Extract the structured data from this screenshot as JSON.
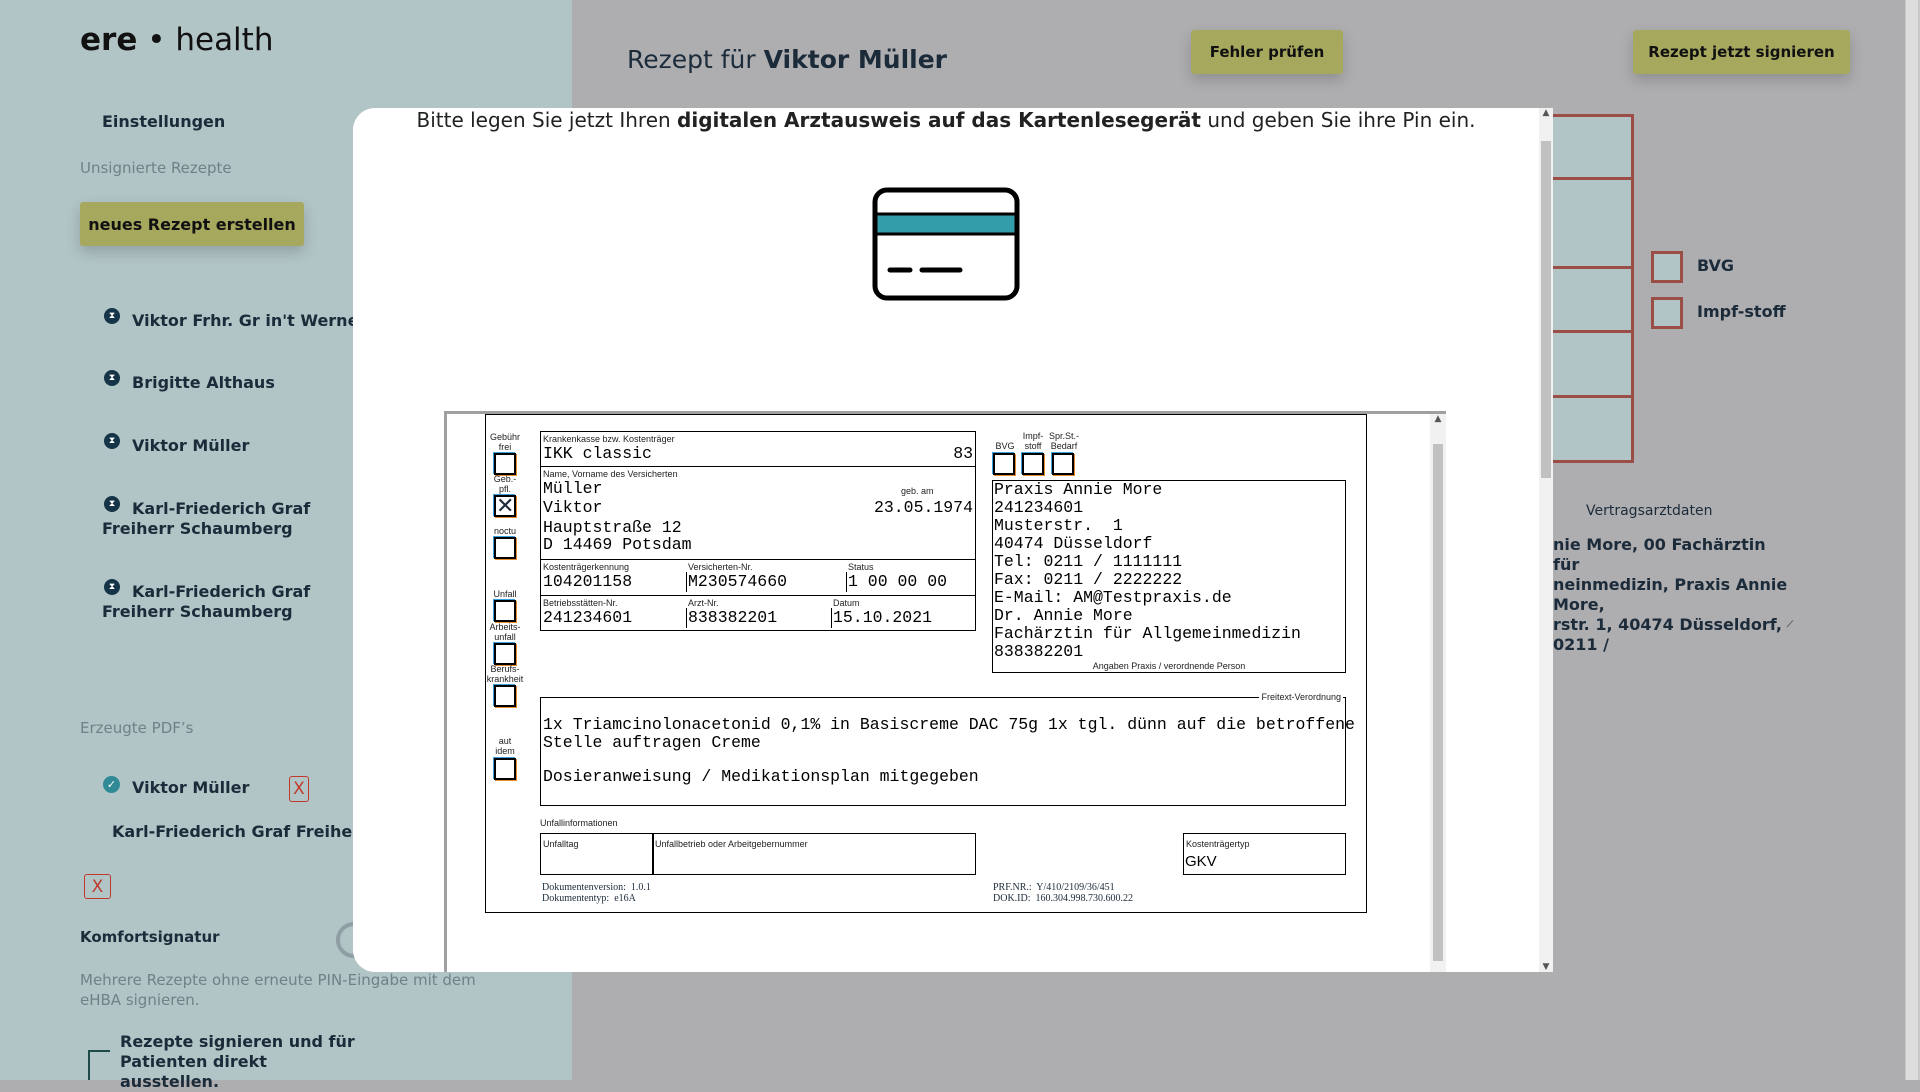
{
  "sidebar": {
    "logo": {
      "left": "ere",
      "right": "health"
    },
    "settings": "Einstellungen",
    "unsigned_heading": "Unsignierte Rezepte",
    "new_button": "neues Rezept erstellen",
    "unsigned": [
      {
        "name": "Viktor Frhr. Gr in't Werner"
      },
      {
        "name": "Brigitte Althaus"
      },
      {
        "name": "Viktor Müller"
      },
      {
        "name": "Karl-Friederich Graf Freiherr Schaumberg"
      },
      {
        "name": "Karl-Friederich Graf Freiherr Schaumberg"
      }
    ],
    "pdf_heading": "Erzeugte PDF’s",
    "pdfs": [
      {
        "name": "Viktor Müller",
        "status": "signed"
      },
      {
        "name": "Karl-Friederich Graf Freiherr vo"
      }
    ],
    "remove_label": "X",
    "comfort_title": "Komfortsignatur",
    "comfort_desc": "Mehrere Rezepte ohne erneute PIN-Eingabe mit dem eHBA signieren.",
    "sign_issue": "Rezepte signieren und für Patienten direkt ausstellen."
  },
  "header": {
    "title_prefix": "Rezept für",
    "title_name": "Viktor Müller",
    "check_button": "Fehler prüfen",
    "sign_button": "Rezept jetzt signieren"
  },
  "form_bg": {
    "checkboxes": [
      {
        "label": "BVG",
        "checked": false
      },
      {
        "label": "Impf-stoff",
        "checked": false
      }
    ],
    "doctor_label": "Vertragsarztdaten",
    "doctor_lines": [
      "nie More, 00 Fachärztin für",
      "neinmedizin, Praxis Annie More,",
      "rstr. 1, 40474 Düsseldorf, 0211 /"
    ]
  },
  "modal": {
    "instruction_pre": "Bitte legen Sie jetzt Ihren ",
    "instruction_bold": "digitalen Arztausweis auf das Kartenlesegerät",
    "instruction_post": " und geben Sie ihre Pin ein.",
    "icon": "credit-card-icon",
    "accent": "#339da9"
  },
  "prescription": {
    "left_checks": [
      {
        "label": "Gebühr frei",
        "checked": false
      },
      {
        "label": "Geb.-pfl.",
        "checked": true
      },
      {
        "label": "noctu",
        "checked": false
      },
      {
        "label": "Unfall",
        "checked": false
      },
      {
        "label": "Arbeits-unfall",
        "checked": false
      },
      {
        "label": "Berufs-krankheit",
        "checked": false
      },
      {
        "label": "aut idem",
        "checked": false
      }
    ],
    "insurer_label": "Krankenkasse bzw. Kostenträger",
    "insurer": "IKK classic",
    "insurer_code": "83",
    "name_label": "Name, Vorname des Versicherten",
    "surname": "Müller",
    "firstname": "Viktor",
    "street": "Hauptstraße 12",
    "city": "D 14469 Potsdam",
    "dob_label": "geb. am",
    "dob": "23.05.1974",
    "kk_label": "Kostenträgerkennung",
    "kk": "104201158",
    "vnr_label": "Versicherten-Nr.",
    "vnr": "M230574660",
    "status_label": "Status",
    "status": "1 00 00 00",
    "bsnr_label": "Betriebsstätten-Nr.",
    "bsnr": "241234601",
    "lanr_label": "Arzt-Nr.",
    "lanr": "838382201",
    "date_label": "Datum",
    "date": "15.10.2021",
    "top_checks": [
      {
        "label": "BVG"
      },
      {
        "label": "Impf-stoff"
      },
      {
        "label": "Spr.St.-Bedarf"
      }
    ],
    "practice_lines": [
      "Praxis Annie More",
      "241234601",
      "Musterstr.  1",
      "40474 Düsseldorf",
      "Tel: 0211 / 1111111",
      "Fax: 0211 / 2222222",
      "E-Mail: AM@Testpraxis.de",
      "Dr. Annie More",
      "Fachärztin für Allgemeinmedizin",
      "838382201"
    ],
    "practice_caption": "Angaben Praxis / verordnende Person",
    "freetext_label": "Freitext-Verordnung",
    "freetext_lines": [
      "1x Triamcinolonacetonid 0,1% in Basiscreme DAC 75g 1x tgl. dünn auf die betroffene",
      "Stelle auftragen Creme",
      "",
      "Dosieranweisung / Medikationsplan mitgegeben"
    ],
    "accident_label": "Unfallinformationen",
    "accident_day": "Unfalltag",
    "accident_company": "Unfallbetrieb oder Arbeitgebernummer",
    "payer_type_label": "Kostenträgertyp",
    "payer_type": "GKV",
    "doc_version": "Dokumentenversion:  1.0.1",
    "doc_type": "Dokumententyp:  e16A",
    "prf": "PRF.NR.:  Y/410/2109/36/451",
    "dok_id": "DOK.ID:  160.304.998.730.600.22"
  }
}
